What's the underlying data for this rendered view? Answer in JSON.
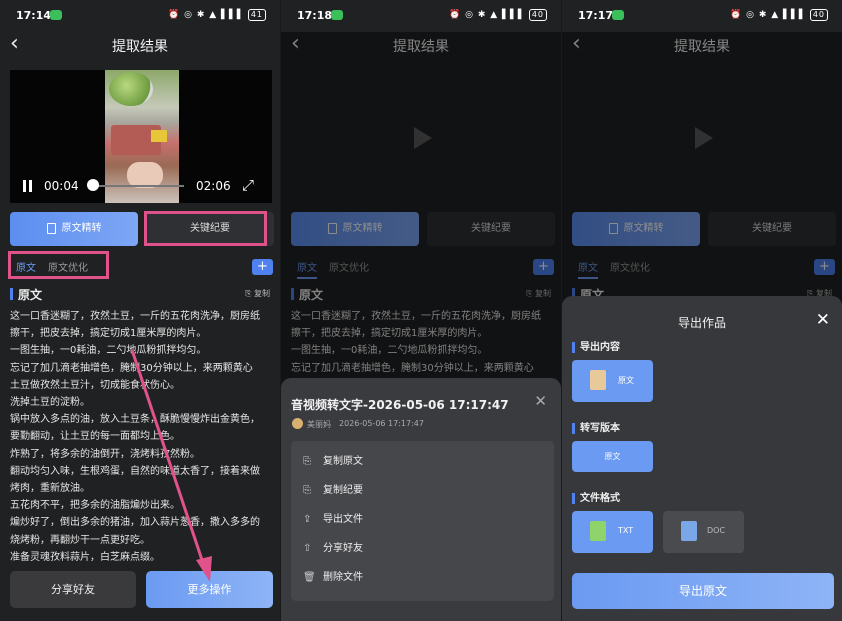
{
  "screens": [
    {
      "status": {
        "time": "17:14",
        "battery": "41"
      },
      "nav_title": "提取结果"
    },
    {
      "status": {
        "time": "17:18",
        "battery": "40"
      },
      "nav_title": "提取结果"
    },
    {
      "status": {
        "time": "17:17",
        "battery": "40"
      },
      "nav_title": "提取结果"
    }
  ],
  "player": {
    "current_time": "00:04",
    "duration": "02:06",
    "progress_fraction": 0.03
  },
  "tabs": {
    "original_transfer": "原文精转",
    "key_summary": "关键纪要"
  },
  "subtabs": {
    "original": "原文",
    "optimize": "原文优化"
  },
  "section": {
    "title": "原文",
    "copy_label": "复制"
  },
  "transcript_lines": [
    "这一口香迷糊了，孜然土豆，一斤的五花肉洗净，厨房纸",
    "擦干，把皮去掉，搞定切成1厘米厚的肉片。",
    "一图生抽，一0耗油，二勺地瓜粉抓拌均匀。",
    "忘记了加几滴老抽增色，腌制30分钟以上，来两颗黄心",
    "土豆做孜然土豆汁，切成能食状伤心。",
    "洗掉土豆的淀粉。",
    "锅中放入多点的油，放入土豆条，酥脆慢慢炸出金黄色，",
    "要勤翻动，让土豆的每一面都均上色。",
    "炸熟了，将多余的油倒开，浇烤料孜然粉。",
    "翻动均匀入味，生根鸡蛋，自然的味道太香了，接着来做",
    "烤肉，重新放油。",
    "五花肉不平，把多余的油脂煸炒出来。",
    "煸炒好了，倒出多余的猪油，加入蒜片葱香，撒入多多的",
    "烧烤粉，再翻炒干一点更好吃。",
    "准备灵魂孜料蒜片，白芝麻点缀。"
  ],
  "bottom": {
    "share": "分享好友",
    "more": "更多操作"
  },
  "sheet": {
    "title": "音视频转文字-2026-05-06 17:17:47",
    "user": "美丽妈",
    "date": "2026-05-06 17:17:47",
    "items": [
      {
        "icon": "copy-icon",
        "label": "复制原文"
      },
      {
        "icon": "copy-icon",
        "label": "复制纪要"
      },
      {
        "icon": "export-icon",
        "label": "导出文件"
      },
      {
        "icon": "share-icon",
        "label": "分享好友"
      },
      {
        "icon": "delete-icon",
        "label": "删除文件"
      }
    ]
  },
  "export": {
    "title": "导出作品",
    "content_label": "导出内容",
    "content_option": "原文",
    "version_label": "转写版本",
    "version_option": "原文",
    "format_label": "文件格式",
    "formats": [
      "TXT",
      "DOC"
    ],
    "button": "导出原文"
  },
  "colors": {
    "accent": "#4f82ee",
    "highlight": "#e0528a",
    "background": "#202123"
  }
}
